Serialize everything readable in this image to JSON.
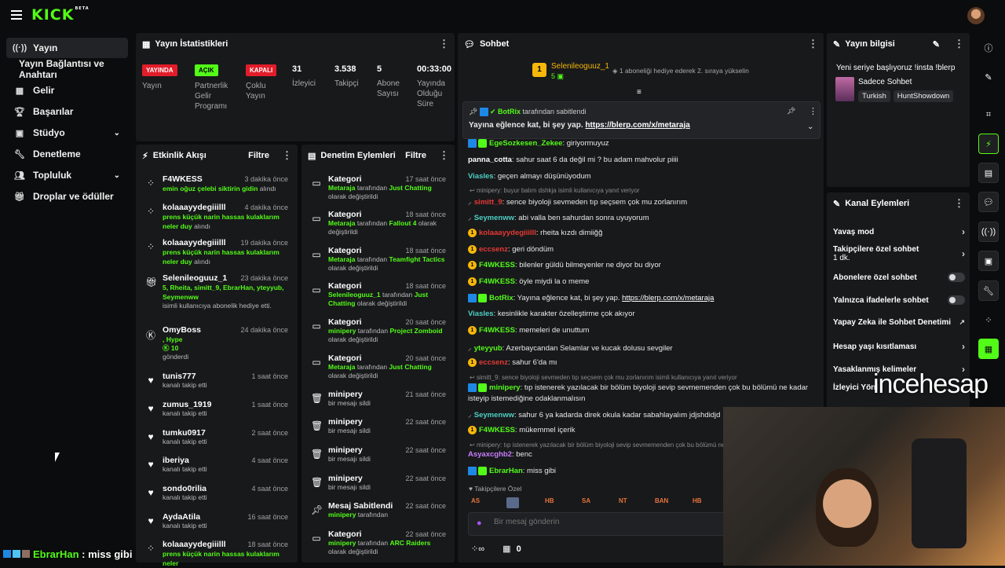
{
  "brand": {
    "logo": "KICK",
    "beta": "BETA"
  },
  "nav": [
    {
      "label": "Yayın",
      "icon": "broadcast-icon",
      "active": true
    },
    {
      "label": "Yayın Bağlantısı ve Anahtarı",
      "icon": "",
      "sub": true
    },
    {
      "label": "Gelir",
      "icon": "income-icon"
    },
    {
      "label": "Başarılar",
      "icon": "trophy-icon"
    },
    {
      "label": "Stüdyo",
      "icon": "studio-icon",
      "expand": true
    },
    {
      "label": "Denetleme",
      "icon": "wrench-icon"
    },
    {
      "label": "Topluluk",
      "icon": "community-icon",
      "expand": true
    },
    {
      "label": "Droplar ve ödüller",
      "icon": "gift-icon"
    }
  ],
  "bottom_chat": {
    "user": "EbrarHan",
    "text": " : miss gibi"
  },
  "stats": {
    "title": "Yayın İstatistikleri",
    "badges": [
      {
        "badge": "YAYINDA",
        "label": "Yayın"
      },
      {
        "badge": "AÇIK",
        "label": "Partnerlik Gelir Programı"
      },
      {
        "badge": "KAPALI",
        "label": "Çoklu Yayın"
      }
    ],
    "numbers": [
      {
        "value": "31",
        "label": "İzleyici"
      },
      {
        "value": "3.538",
        "label": "Takipçi"
      },
      {
        "value": "5",
        "label": "Abone Sayısı"
      },
      {
        "value": "00:33:00",
        "label": "Yayında Olduğu Süre"
      }
    ]
  },
  "activity": {
    "title": "Etkinlik Akışı",
    "filter": "Filtre",
    "items": [
      {
        "name": "F4WKESS",
        "time": "3 dakika önce",
        "green": "emin oğuz çelebi sikt",
        "green2": "irin gidin",
        "sub": " alındı",
        "icon": "sound-icon"
      },
      {
        "name": "kolaaayydegiiilll",
        "time": "4 dakika önce",
        "green": "prens küçük narin hassas kulaklarım neler duy",
        "sub": " alındı",
        "icon": "sound-icon"
      },
      {
        "name": "kolaaayydegiiilll",
        "time": "19 dakika önce",
        "green": "prens küçük narin hassas kulaklarım neler duy",
        "sub": " alındı",
        "icon": "sound-icon"
      },
      {
        "name": "Selenileoguuz_1",
        "time": "23 dakika önce",
        "green": "5, Rheita, simitt_9, EbrarHan, yteyyub, Seymenww",
        "sub": "isimli kullanıcıya abonelik hediye etti.",
        "icon": "gift-icon"
      },
      {
        "name": "OmyBoss",
        "time": "24 dakika önce",
        "green": ", Hype",
        "count": "10",
        "sub": "gönderdi",
        "icon": "kick-icon"
      },
      {
        "name": "tunis777",
        "time": "1 saat önce",
        "sub": "kanalı takip etti",
        "icon": "heart-icon"
      },
      {
        "name": "zumus_1919",
        "time": "1 saat önce",
        "sub": "kanalı takip etti",
        "icon": "heart-icon"
      },
      {
        "name": "tumku0917",
        "time": "2 saat önce",
        "sub": "kanalı takip etti",
        "icon": "heart-icon"
      },
      {
        "name": "iberiya",
        "time": "4 saat önce",
        "sub": "kanalı takip etti",
        "icon": "heart-icon"
      },
      {
        "name": "sondo0rilia",
        "time": "4 saat önce",
        "sub": "kanalı takip etti",
        "icon": "heart-icon"
      },
      {
        "name": "AydaAtila",
        "time": "16 saat önce",
        "sub": "kanalı takip etti",
        "icon": "heart-icon"
      },
      {
        "name": "kolaaayydegiiilll",
        "time": "18 saat önce",
        "green": "prens küçük narin hassas kulaklarım neler",
        "sub": "",
        "icon": "sound-icon"
      }
    ]
  },
  "moderation": {
    "title": "Denetim Eylemleri",
    "filter": "Filtre",
    "items": [
      {
        "title": "Kategori",
        "time": "17 saat önce",
        "user": "Metaraja",
        "mid": " tarafından ",
        "target": "Just Chatting",
        "tail": " olarak değiştirildi",
        "icon": "category-icon"
      },
      {
        "title": "Kategori",
        "time": "18 saat önce",
        "user": "Metaraja",
        "mid": " tarafından ",
        "target": "Fallout 4",
        "tail": " olarak değiştirildi",
        "icon": "category-icon"
      },
      {
        "title": "Kategori",
        "time": "18 saat önce",
        "user": "Metaraja",
        "mid": " tarafından ",
        "target": "Teamfight Tactics",
        "tail": " olarak değiştirildi",
        "icon": "category-icon"
      },
      {
        "title": "Kategori",
        "time": "18 saat önce",
        "user": "Selenileoguuz_1",
        "mid": " tarafından ",
        "target": "Just Chatting",
        "tail": " olarak değiştirildi",
        "icon": "category-icon"
      },
      {
        "title": "Kategori",
        "time": "20 saat önce",
        "user": "minipery",
        "mid": " tarafından ",
        "target": "Project Zomboid",
        "tail": " olarak değiştirildi",
        "icon": "category-icon"
      },
      {
        "title": "Kategori",
        "time": "20 saat önce",
        "user": "Metaraja",
        "mid": " tarafından ",
        "target": "Just Chatting",
        "tail": " olarak değiştirildi",
        "icon": "category-icon"
      },
      {
        "title": "minipery",
        "time": "21 saat önce",
        "sub": "bir mesajı sildi",
        "icon": "trash-icon"
      },
      {
        "title": "minipery",
        "time": "22 saat önce",
        "sub": "bir mesajı sildi",
        "icon": "trash-icon"
      },
      {
        "title": "minipery",
        "time": "22 saat önce",
        "sub": "bir mesajı sildi",
        "icon": "trash-icon"
      },
      {
        "title": "minipery",
        "time": "22 saat önce",
        "sub": "bir mesajı sildi",
        "icon": "trash-icon"
      },
      {
        "title": "Mesaj Sabitlendi",
        "time": "22 saat önce",
        "user": "minipery",
        "mid": " tarafından",
        "icon": "pin-icon"
      },
      {
        "title": "Kategori",
        "time": "22 saat önce",
        "user": "minipery",
        "mid": " tarafından ",
        "target": "ARC Raiders",
        "tail": " olarak değiştirildi",
        "icon": "category-icon"
      }
    ]
  },
  "chat": {
    "title": "Sohbet",
    "gift_user": "Selenileoguuz_1",
    "gift_count": "5",
    "gift_text": "1 aboneliği hediye ederek 2. sıraya yükselin",
    "pinned_by_user": "BotRix",
    "pinned_by_text": " tarafından sabitlendi",
    "pinned_text": "Yayına eğlence kat, bi şey yap. ",
    "pinned_link": "https://blerp.com/x/metaraja",
    "messages": [
      {
        "user": "EgeSozkesen_Zekee",
        "color": "#53fc18",
        "text": ": giriyormuyuz",
        "badges": "bluegreen"
      },
      {
        "user": "panna_cotta",
        "color": "#ffffff",
        "text": ": sahur saat 6 da değil mi ? bu adam mahvolur piiii"
      },
      {
        "user": "Viasles",
        "color": "#4ecfc4",
        "text": ": geçen almayı düşünüyodum"
      },
      {
        "reply": "minipery: buyur balım dshkja isimli kullanıcıya yanıt veriyor"
      },
      {
        "user": "simitt_9",
        "color": "#e53935",
        "text": ": sence biyoloji sevmeden tıp seçsem çok mu zorlanırım",
        "badges": "sword"
      },
      {
        "user": "Seymenww",
        "color": "#4ecfc4",
        "text": ": abi valla ben sahurdan sonra uyuyorum",
        "badges": "sword"
      },
      {
        "user": "kolaaayydegiiilll",
        "color": "#e53935",
        "text": ": rheita kızdı dimiiğğ",
        "badges": "gold"
      },
      {
        "user": "eccsenz",
        "color": "#e53935",
        "text": ": geri döndüm",
        "badges": "gold"
      },
      {
        "user": "F4WKESS",
        "color": "#53fc18",
        "text": ": bilenler güldü bilmeyenler ne diyor bu diyor",
        "badges": "gold"
      },
      {
        "user": "F4WKESS",
        "color": "#53fc18",
        "text": ": öyle miydi la o meme",
        "badges": "gold"
      },
      {
        "user": "BotRix",
        "color": "#53fc18",
        "text": ": Yayına eğlence kat, bi şey yap. ",
        "link": "https://blerp.com/x/metaraja",
        "badges": "bluegreen"
      },
      {
        "user": "Viasles",
        "color": "#4ecfc4",
        "text": ": kesinlikle karakter özelleştirme çok akıyor"
      },
      {
        "user": "F4WKESS",
        "color": "#53fc18",
        "text": ": memeleri de unuttum",
        "badges": "gold"
      },
      {
        "user": "yteyyub",
        "color": "#53fc18",
        "text": ": Azerbaycandan Selamlar ve kucak dolusu sevgiler",
        "badges": "sword"
      },
      {
        "user": "eccsenz",
        "color": "#e53935",
        "text": ": sahur 6'da mı",
        "badges": "gold"
      },
      {
        "reply": "simitt_9: sence biyoloji sevmeden tıp seçsem çok mu zorlanırım isimli kullanıcıya yanıt veriyor"
      },
      {
        "user": "minipery",
        "color": "#53fc18",
        "text": ": tıp istenerek yazılacak bir bölüm biyoloji sevip sevmemenden çok bu bölümü ne kadar",
        "badges": "bluegreen"
      },
      {
        "cont": "isteyip istemediğine odaklanmalısın"
      },
      {
        "user": "Seymenww",
        "color": "#4ecfc4",
        "text": ": sahur 6 ya kadarda direk okula kadar sabahlayalım jdjshdidjd",
        "badges": "sword"
      },
      {
        "user": "F4WKESS",
        "color": "#53fc18",
        "text": ": mükemmel içerik",
        "badges": "gold"
      },
      {
        "reply": "minipery: tıp istenerek yazılacak bir bölüm biyoloji sevip sevmemenden çok bu bölümü ne ka"
      },
      {
        "user": "Asyaxcghb2",
        "color": "#c77dff",
        "text": ": benc"
      },
      {
        "user": "EbrarHan",
        "color": "#53fc18",
        "text": ": miss gibi",
        "badges": "bluegreen"
      }
    ],
    "followers_only": "Takipçilere Özel",
    "emotes": [
      "AS",
      "",
      "HB",
      "SA",
      "NT",
      "BAN",
      "HB"
    ],
    "input_placeholder": "Bir mesaj gönderin",
    "bottom_count": "0"
  },
  "stream_info": {
    "title": "Yayın bilgisi",
    "stream_title": "Yeni seriye başlıyoruz !insta !blerp",
    "category_label": "Sadece Sohbet",
    "tags": [
      "Turkish",
      "HuntShowdown"
    ]
  },
  "channel_actions": {
    "title": "Kanal Eylemleri",
    "rows": [
      {
        "label": "Yavaş mod",
        "control": "chevron"
      },
      {
        "label": "Takipçilere özel sohbet",
        "sub": "1 dk.",
        "control": "chevron"
      },
      {
        "label": "Abonelere özel sohbet",
        "control": "toggle"
      },
      {
        "label": "Yalnızca ifadelerle sohbet",
        "control": "toggle"
      },
      {
        "label": "Yapay Zeka ile Sohbet Denetimi",
        "control": "external"
      },
      {
        "label": "Hesap yaşı kısıtlaması",
        "control": "chevron"
      },
      {
        "label": "Yasaklanmış kelimeler",
        "control": "chevron"
      },
      {
        "label": "İzleyici Yönl",
        "control": "none"
      }
    ]
  },
  "watermark": "incehesap"
}
